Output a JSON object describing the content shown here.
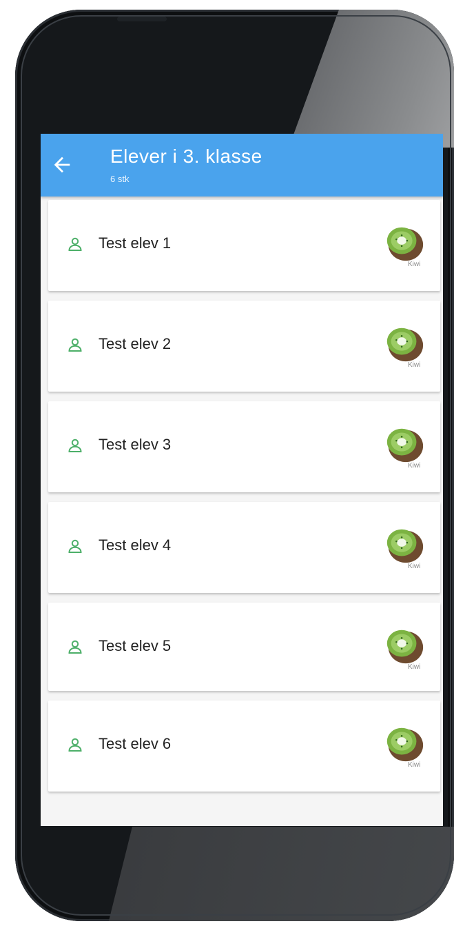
{
  "header": {
    "title": "Elever i 3. klasse",
    "subtitle": "6 stk"
  },
  "students": [
    {
      "name": "Test elev 1",
      "group": "Kiwi"
    },
    {
      "name": "Test elev 2",
      "group": "Kiwi"
    },
    {
      "name": "Test elev 3",
      "group": "Kiwi"
    },
    {
      "name": "Test elev 4",
      "group": "Kiwi"
    },
    {
      "name": "Test elev 5",
      "group": "Kiwi"
    },
    {
      "name": "Test elev 6",
      "group": "Kiwi"
    }
  ],
  "icons": {
    "back": "arrow-left-icon",
    "student": "person-icon",
    "group": "kiwi-icon"
  },
  "colors": {
    "app_bar": "#4aa3ed",
    "person_icon": "#4caf68",
    "kiwi_green": "#8bc34a",
    "kiwi_skin": "#7a5a3a"
  }
}
